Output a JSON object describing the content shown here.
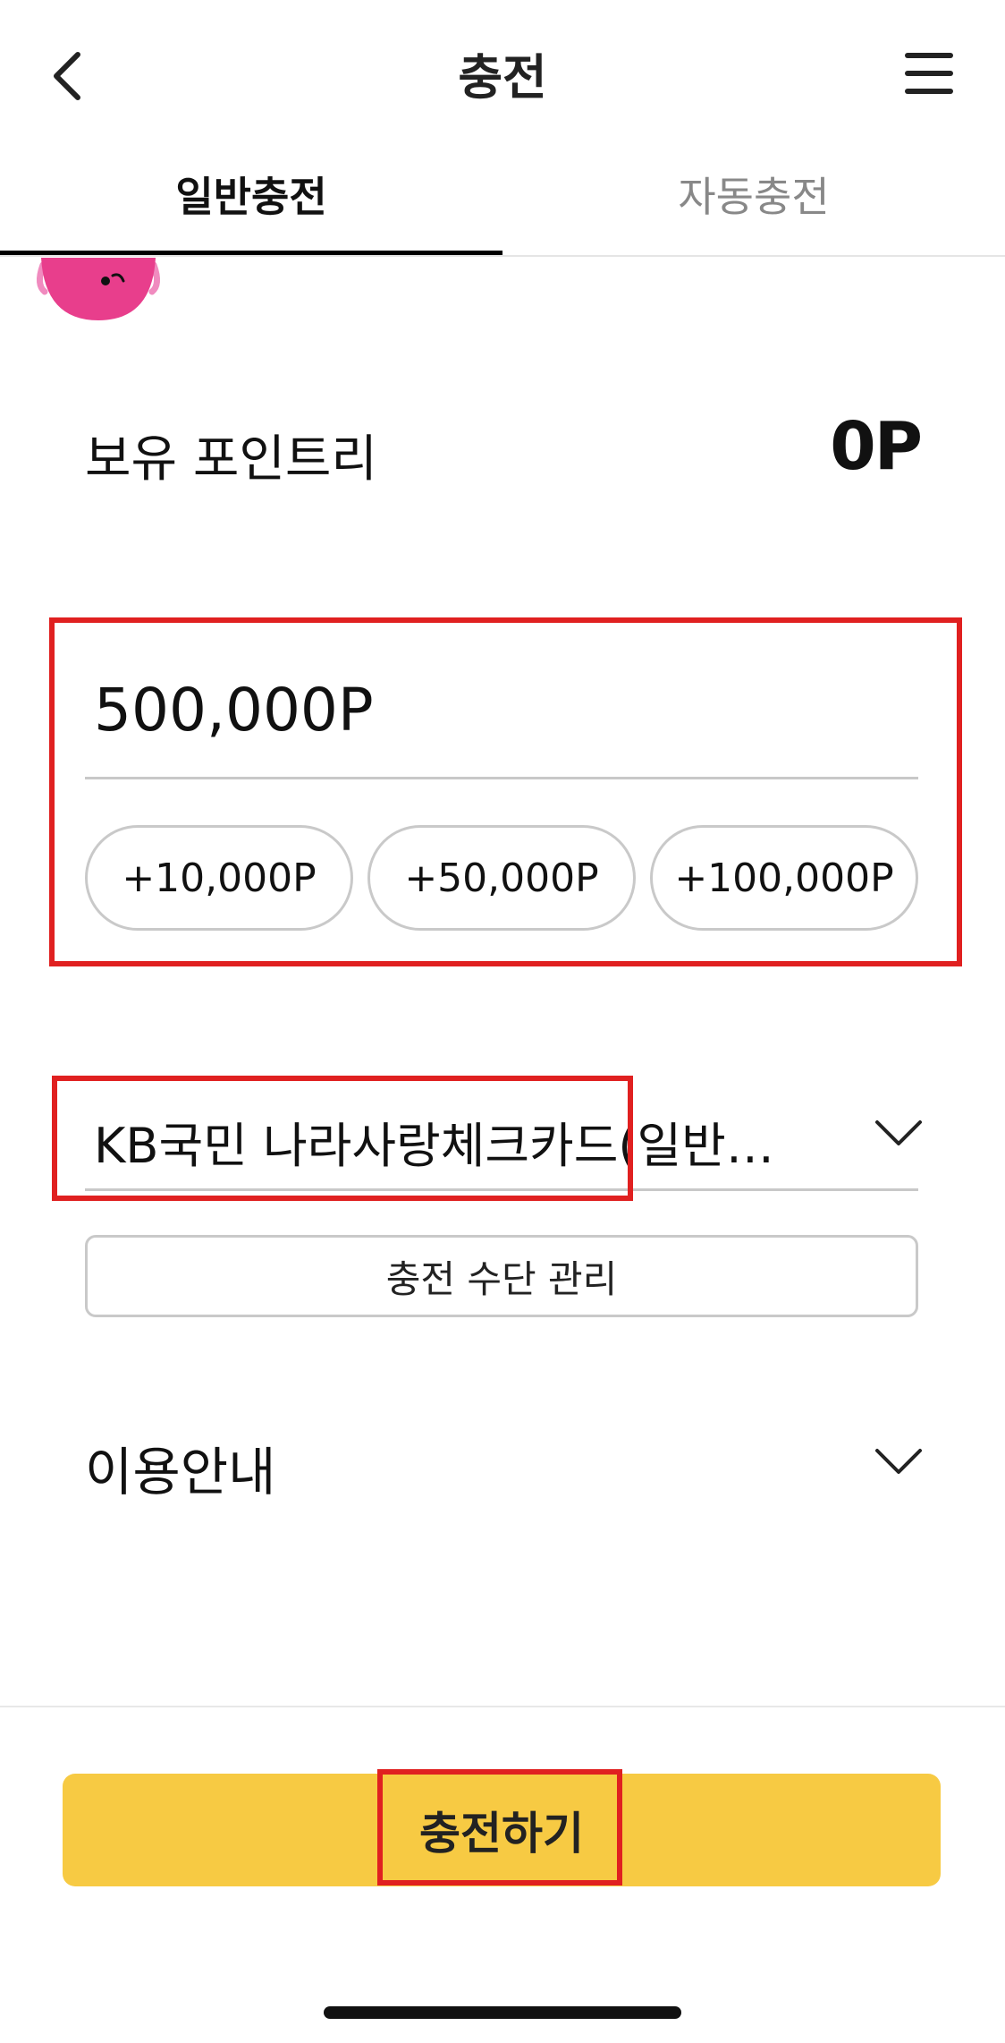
{
  "header": {
    "title": "충전",
    "back_icon": "chevron-left-icon",
    "menu_icon": "hamburger-menu-icon"
  },
  "tabs": [
    {
      "label": "일반충전",
      "active": true
    },
    {
      "label": "자동충전",
      "active": false
    }
  ],
  "balance": {
    "label": "보유 포인트리",
    "value": "0P"
  },
  "amount": {
    "value": "500,000P",
    "quick_add": [
      "+10,000P",
      "+50,000P",
      "+100,000P"
    ]
  },
  "payment": {
    "selected": "KB국민 나라사랑체크카드(일반형 ...",
    "manage_label": "충전 수단 관리"
  },
  "info": {
    "label": "이용안내"
  },
  "footer": {
    "charge_label": "충전하기"
  },
  "colors": {
    "accent_yellow": "#f7ca43",
    "highlight_red": "#e02020",
    "mascot_pink": "#e83e8c"
  }
}
